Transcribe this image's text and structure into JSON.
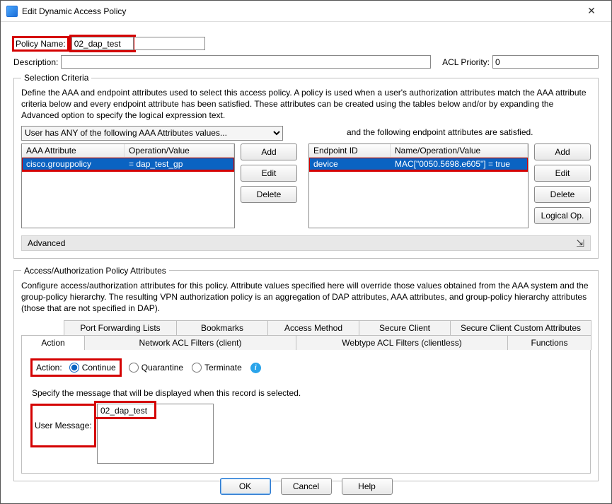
{
  "window": {
    "title": "Edit Dynamic Access Policy"
  },
  "policy": {
    "name_label": "Policy Name:",
    "name_value": "02_dap_test",
    "desc_label": "Description:",
    "desc_value": "",
    "acl_label": "ACL Priority:",
    "acl_value": "0"
  },
  "criteria": {
    "legend": "Selection Criteria",
    "desc": "Define the AAA and endpoint attributes used to select this access policy. A policy is used when a user's authorization attributes match the AAA attribute criteria below and every endpoint attribute has been satisfied. These attributes can be created using the tables below and/or by expanding the Advanced option to specify the logical expression text.",
    "combo_label": "User has ANY of the following AAA Attributes values...",
    "endpoint_note": "and the following endpoint attributes are satisfied.",
    "aaa_headers": {
      "c1": "AAA Attribute",
      "c2": "Operation/Value"
    },
    "aaa_row": {
      "c1": "cisco.grouppolicy",
      "c2": "=   dap_test_gp"
    },
    "ep_headers": {
      "c1": "Endpoint ID",
      "c2": "Name/Operation/Value"
    },
    "ep_row": {
      "c1": "device",
      "c2": "MAC[\"0050.5698.e605\"]   =  true"
    },
    "btn_add": "Add",
    "btn_edit": "Edit",
    "btn_delete": "Delete",
    "btn_logical": "Logical Op.",
    "advanced": "Advanced"
  },
  "attrs": {
    "legend": "Access/Authorization Policy Attributes",
    "desc": "Configure access/authorization attributes for this policy. Attribute values specified here will override those values obtained from the AAA system and the group-policy hierarchy. The resulting VPN authorization policy is an aggregation of DAP attributes, AAA attributes, and group-policy hierarchy attributes (those that are not specified in DAP).",
    "tabs_top": {
      "t1": "Port Forwarding Lists",
      "t2": "Bookmarks",
      "t3": "Access Method",
      "t4": "Secure Client",
      "t5": "Secure Client Custom Attributes"
    },
    "tabs_bottom": {
      "t1": "Action",
      "t2": "Network ACL Filters (client)",
      "t3": "Webtype ACL Filters (clientless)",
      "t4": "Functions"
    },
    "action_label": "Action:",
    "opt_continue": "Continue",
    "opt_quarantine": "Quarantine",
    "opt_terminate": "Terminate",
    "msg_intro": "Specify the message that will be displayed when this record is selected.",
    "msg_label": "User Message:",
    "msg_value": "02_dap_test"
  },
  "footer": {
    "ok": "OK",
    "cancel": "Cancel",
    "help": "Help"
  }
}
